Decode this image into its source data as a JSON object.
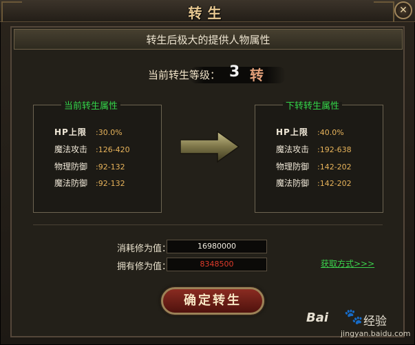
{
  "window": {
    "title": "转生",
    "close_symbol": "✕"
  },
  "banner": {
    "text": "转生后极大的提供人物属性"
  },
  "level": {
    "label": "当前转生等级：",
    "value": "3",
    "unit": "转"
  },
  "current": {
    "title": "当前转生属性",
    "stats": [
      {
        "label": "HP上限",
        "value": ":30.0%"
      },
      {
        "label": "魔法攻击",
        "value": ":126-420"
      },
      {
        "label": "物理防御",
        "value": ":92-132"
      },
      {
        "label": "魔法防御",
        "value": ":92-132"
      }
    ]
  },
  "next": {
    "title": "下转转生属性",
    "stats": [
      {
        "label": "HP上限",
        "value": ":40.0%"
      },
      {
        "label": "魔法攻击",
        "value": ":192-638"
      },
      {
        "label": "物理防御",
        "value": ":142-202"
      },
      {
        "label": "魔法防御",
        "value": ":142-202"
      }
    ]
  },
  "cost": {
    "consume_label": "消耗修为值：",
    "consume_value": "16980000",
    "own_label": "拥有修为值：",
    "own_value": "8348500",
    "get_link": "获取方式>>>"
  },
  "confirm_button": "确定转生",
  "watermark": {
    "brand": "Bai",
    "paw": "🐾",
    "cn": "经验",
    "url": "jingyan.baidu.com"
  },
  "colors": {
    "accent_green": "#35d64a",
    "value_orange": "#e8b45b",
    "insufficient_red": "#e23b2b",
    "button_red": "#8a2b21"
  }
}
